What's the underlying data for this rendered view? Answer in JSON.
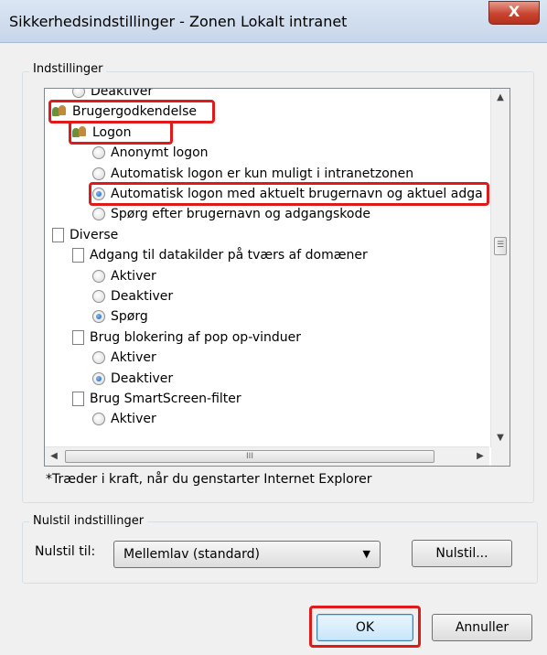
{
  "window": {
    "title": "Sikkerhedsindstillinger - Zonen Lokalt intranet",
    "close_glyph": "X"
  },
  "settings": {
    "legend": "Indstillinger",
    "tree": [
      {
        "kind": "radio",
        "label": "Deaktiver",
        "checked": false,
        "indent": 1,
        "highlight": false
      },
      {
        "kind": "users",
        "label": "Brugergodkendelse",
        "indent": 0,
        "highlight": true
      },
      {
        "kind": "users",
        "label": "Logon",
        "indent": 1,
        "highlight": true
      },
      {
        "kind": "radio",
        "label": "Anonymt logon",
        "checked": false,
        "indent": 2,
        "highlight": false
      },
      {
        "kind": "radio",
        "label": "Automatisk logon er kun muligt i intranetzonen",
        "checked": false,
        "indent": 2,
        "highlight": false
      },
      {
        "kind": "radio",
        "label": "Automatisk logon med aktuelt brugernavn og aktuel adga",
        "checked": true,
        "indent": 2,
        "highlight": true
      },
      {
        "kind": "radio",
        "label": "Spørg efter brugernavn og adgangskode",
        "checked": false,
        "indent": 2,
        "highlight": false
      },
      {
        "kind": "page",
        "label": "Diverse",
        "indent": 0,
        "highlight": false
      },
      {
        "kind": "page",
        "label": "Adgang til datakilder på tværs af domæner",
        "indent": 1,
        "highlight": false
      },
      {
        "kind": "radio",
        "label": "Aktiver",
        "checked": false,
        "indent": 2,
        "highlight": false
      },
      {
        "kind": "radio",
        "label": "Deaktiver",
        "checked": false,
        "indent": 2,
        "highlight": false
      },
      {
        "kind": "radio",
        "label": "Spørg",
        "checked": true,
        "indent": 2,
        "highlight": false
      },
      {
        "kind": "page",
        "label": "Brug blokering af pop op-vinduer",
        "indent": 1,
        "highlight": false
      },
      {
        "kind": "radio",
        "label": "Aktiver",
        "checked": false,
        "indent": 2,
        "highlight": false
      },
      {
        "kind": "radio",
        "label": "Deaktiver",
        "checked": true,
        "indent": 2,
        "highlight": false
      },
      {
        "kind": "page",
        "label": "Brug SmartScreen-filter",
        "indent": 1,
        "highlight": false
      },
      {
        "kind": "radio",
        "label": "Aktiver",
        "checked": false,
        "indent": 2,
        "highlight": false
      }
    ],
    "scroll_up": "▲",
    "scroll_down": "▼",
    "scroll_left": "◀",
    "scroll_right": "▶",
    "thumb_grip_v": "☰",
    "thumb_grip_h": "III",
    "note": "*Træder i kraft, når du genstarter Internet Explorer"
  },
  "reset": {
    "legend": "Nulstil indstillinger",
    "label": "Nulstil til:",
    "selected": "Mellemlav (standard)",
    "caret": "▼",
    "button": "Nulstil..."
  },
  "footer": {
    "ok": "OK",
    "cancel": "Annuller"
  },
  "colors": {
    "highlight": "#e01a1a",
    "window_bg": "#f0f0f0"
  }
}
